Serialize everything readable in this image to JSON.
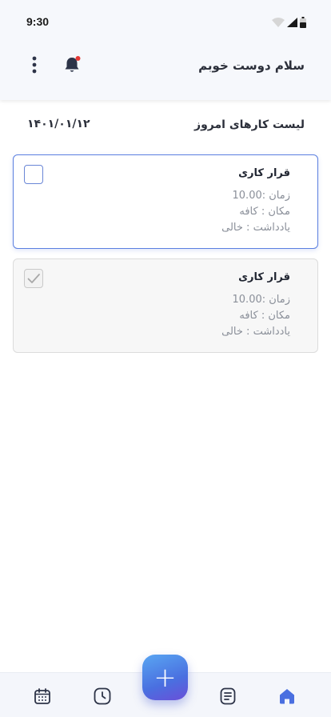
{
  "status_bar": {
    "time": "9:30",
    "icons": [
      "wifi-icon",
      "signal-icon",
      "battery-icon"
    ]
  },
  "header": {
    "greeting": "سلام دوست خوبم",
    "notification_icon": "bell-icon",
    "notification_dot_color": "#e53935",
    "menu_icon": "more-vertical-icon"
  },
  "section": {
    "title": "لیست کارهای امروز",
    "date": "۱۴۰۱/۰۱/۱۲"
  },
  "tasks": [
    {
      "title": "قرار کاری",
      "time": "زمان :10.00",
      "location": "مکان : کافه",
      "note": "یادداشت : خالی",
      "completed": false
    },
    {
      "title": "قرار کاری",
      "time": "زمان :10.00",
      "location": "مکان : کافه",
      "note": "یادداشت : خالی",
      "completed": true
    }
  ],
  "bottom_nav": {
    "items": [
      "calendar-icon",
      "clock-icon",
      "notes-icon",
      "home-icon"
    ],
    "active": "home-icon",
    "active_color": "#4a6fe0",
    "fab_label": "+"
  },
  "colors": {
    "accent": "#4a6fe0",
    "header_bg": "#f6f8fc"
  }
}
